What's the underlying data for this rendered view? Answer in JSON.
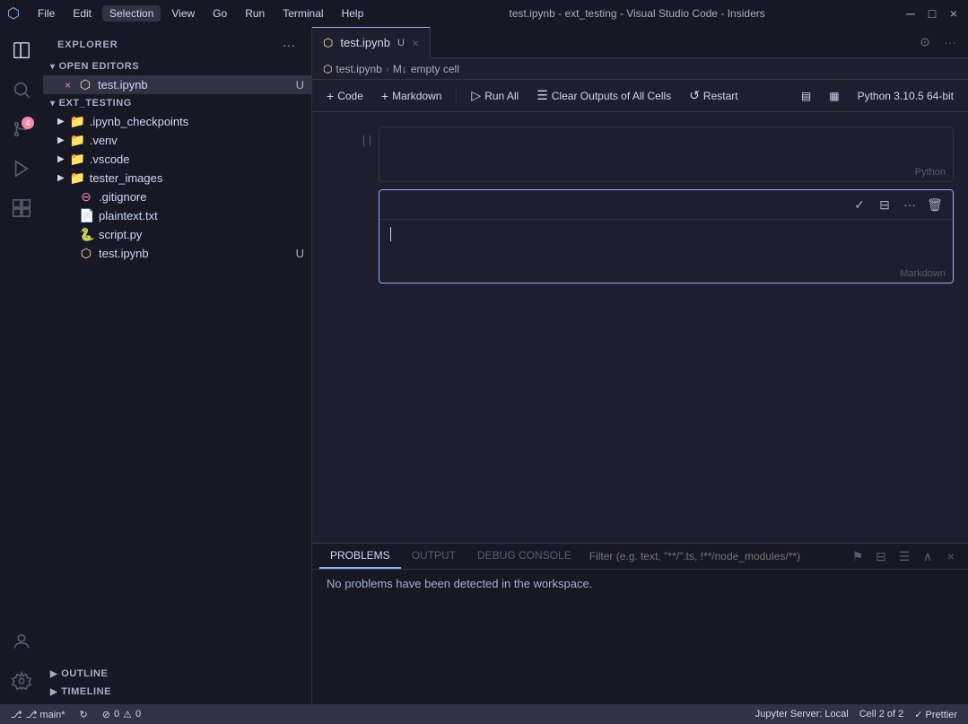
{
  "titlebar": {
    "icon": "⬡",
    "menu": [
      "File",
      "Edit",
      "Selection",
      "View",
      "Go",
      "Run",
      "Terminal",
      "Help"
    ],
    "title": "test.ipynb - ext_testing - Visual Studio Code - Insiders",
    "controls": [
      "─",
      "□",
      "×"
    ]
  },
  "activity_bar": {
    "icons": [
      {
        "name": "explorer-icon",
        "symbol": "⎘",
        "active": true
      },
      {
        "name": "search-icon",
        "symbol": "🔍"
      },
      {
        "name": "source-control-icon",
        "symbol": "⑂",
        "badge": "4"
      },
      {
        "name": "run-icon",
        "symbol": "▷"
      },
      {
        "name": "extensions-icon",
        "symbol": "⊞"
      }
    ],
    "bottom_icons": [
      {
        "name": "account-icon",
        "symbol": "👤"
      },
      {
        "name": "settings-icon",
        "symbol": "⚙"
      }
    ]
  },
  "sidebar": {
    "title": "EXPLORER",
    "open_editors": {
      "label": "OPEN EDITORS",
      "files": [
        {
          "name": "test.ipynb",
          "modified": "U",
          "active": true,
          "type": "notebook"
        }
      ]
    },
    "ext_testing": {
      "label": "EXT_TESTING",
      "items": [
        {
          "name": ".ipynb_checkpoints",
          "type": "folder"
        },
        {
          "name": ".venv",
          "type": "folder"
        },
        {
          "name": ".vscode",
          "type": "folder"
        },
        {
          "name": "tester_images",
          "type": "folder"
        },
        {
          "name": ".gitignore",
          "type": "git"
        },
        {
          "name": "plaintext.txt",
          "type": "text"
        },
        {
          "name": "script.py",
          "type": "python"
        },
        {
          "name": "test.ipynb",
          "type": "notebook",
          "modified": "U"
        }
      ]
    }
  },
  "editor": {
    "tab": {
      "filename": "test.ipynb",
      "modified": true
    },
    "breadcrumb": {
      "parts": [
        "test.ipynb",
        "M↓ empty cell"
      ]
    },
    "toolbar": {
      "code_label": "+ Code",
      "markdown_label": "+ Markdown",
      "run_all_label": "▷ Run All",
      "clear_outputs_label": "Clear Outputs of All Cells",
      "restart_label": "↺ Restart",
      "kernel_label": "Python 3.10.5 64-bit"
    },
    "cells": [
      {
        "id": "cell-1",
        "type": "code",
        "gutter": "[ ]",
        "content": "",
        "lang_label": "Python"
      },
      {
        "id": "cell-2",
        "type": "markdown",
        "gutter": "",
        "content": "",
        "lang_label": "Markdown",
        "active": true
      }
    ]
  },
  "panel": {
    "tabs": [
      "PROBLEMS",
      "OUTPUT",
      "DEBUG CONSOLE"
    ],
    "active_tab": "PROBLEMS",
    "filter_placeholder": "Filter (e.g. text, \"**/\".ts, !**/node_modules/**)",
    "content": "No problems have been detected in the workspace."
  },
  "status_bar": {
    "left": [
      {
        "label": "⎇ main*",
        "name": "git-branch"
      },
      {
        "label": "↻",
        "name": "sync"
      },
      {
        "label": "⊘ 0 ⚠ 0",
        "name": "problems-count"
      }
    ],
    "right": [
      {
        "label": "Jupyter Server: Local",
        "name": "jupyter-server"
      },
      {
        "label": "Cell 2 of 2",
        "name": "cell-position"
      },
      {
        "label": "✓ Prettier",
        "name": "prettier"
      }
    ]
  },
  "bottom_panel": {
    "outline_label": "OUTLINE",
    "timeline_label": "TIMELINE"
  }
}
